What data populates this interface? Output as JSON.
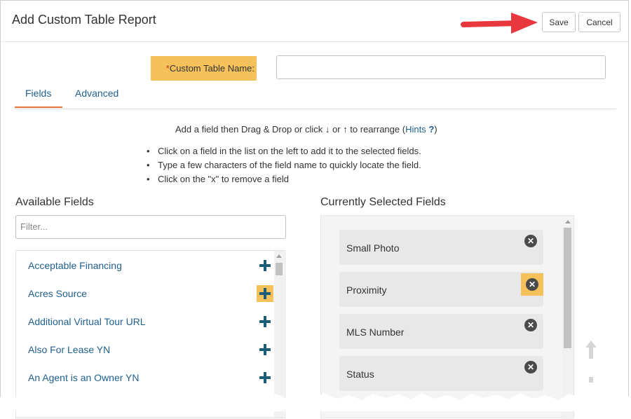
{
  "dialog": {
    "title": "Add Custom Table Report",
    "save_label": "Save",
    "cancel_label": "Cancel"
  },
  "form": {
    "name_required_mark": "*",
    "name_label": "Custom Table Name:",
    "name_value": ""
  },
  "tabs": [
    {
      "label": "Fields",
      "active": true
    },
    {
      "label": "Advanced",
      "active": false
    }
  ],
  "instructions": {
    "line_prefix": "Add a field then Drag & Drop or click ",
    "down_arrow": "↓",
    "or": " or ",
    "up_arrow": "↑",
    "line_suffix": " to rearrange (",
    "hints_label": "Hints",
    "hints_icon": "?",
    "close_paren": ")",
    "bullets": [
      "Click on a field in the list on the left to add it to the selected fields.",
      "Type a few characters of the field name to quickly locate the field.",
      "Click on the \"x\" to remove a field"
    ]
  },
  "available": {
    "title": "Available Fields",
    "filter_placeholder": "Filter...",
    "items": [
      {
        "label": "Acceptable Financing",
        "highlighted": false
      },
      {
        "label": "Acres Source",
        "highlighted": true
      },
      {
        "label": "Additional Virtual Tour URL",
        "highlighted": false
      },
      {
        "label": "Also For Lease YN",
        "highlighted": false
      },
      {
        "label": "An Agent is an Owner YN",
        "highlighted": false
      }
    ],
    "icon": "plus-icon"
  },
  "selected": {
    "title": "Currently Selected Fields",
    "items": [
      {
        "label": "Small Photo",
        "highlighted": false
      },
      {
        "label": "Proximity",
        "highlighted": true
      },
      {
        "label": "MLS Number",
        "highlighted": false
      },
      {
        "label": "Status",
        "highlighted": false
      }
    ],
    "remove_icon": "x-circle-icon",
    "remove_glyph": "✕"
  },
  "colors": {
    "highlight": "#f4c15a",
    "link": "#1f5f8b",
    "plus": "#1e5d78",
    "arrow": "#e8373d",
    "tab_underline": "#e8743b"
  }
}
